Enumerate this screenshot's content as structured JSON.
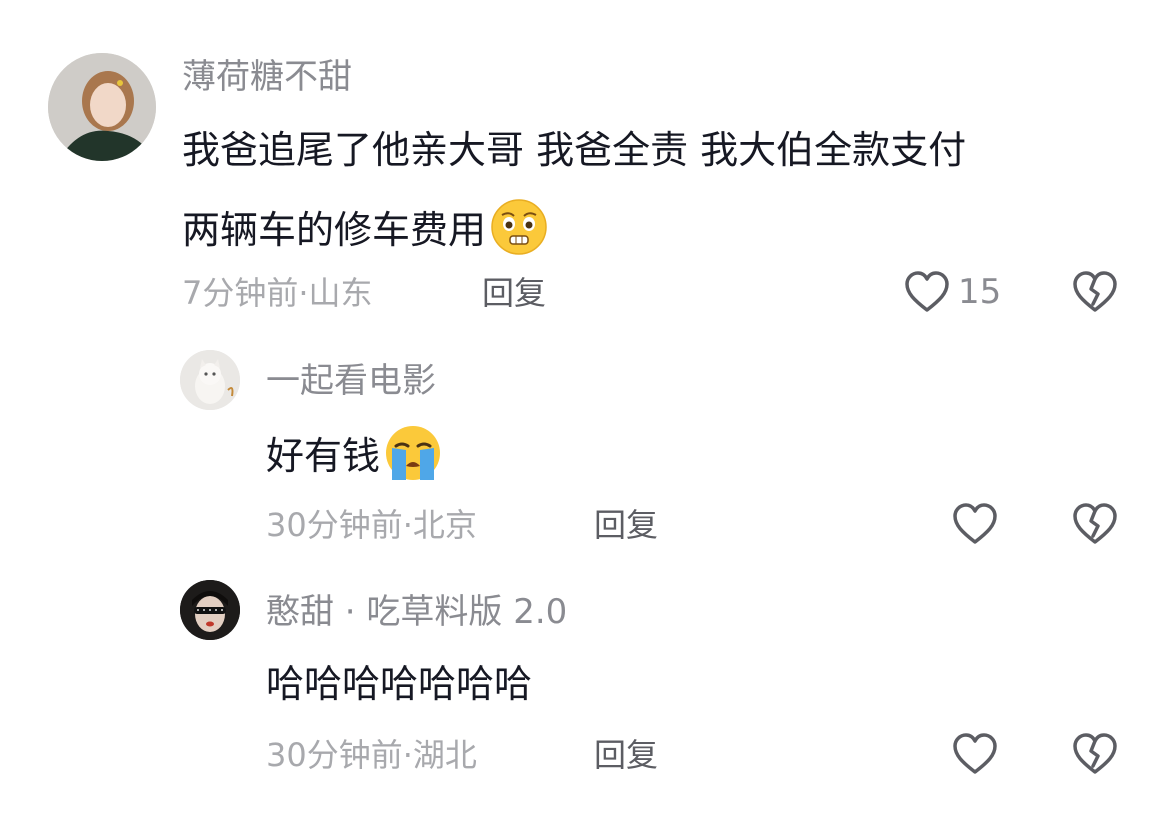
{
  "comments": [
    {
      "username": "薄荷糖不甜",
      "text_line1": "我爸追尾了他亲大哥 我爸全责 我大伯全款支付",
      "text_line2": "两辆车的修车费用",
      "emoji": "grimacing-pleading-face",
      "time": "7分钟前",
      "location": "山东",
      "reply_label": "回复",
      "likes": "15"
    },
    {
      "username": "一起看电影",
      "text": "好有钱",
      "emoji": "loudly-crying-face",
      "time": "30分钟前",
      "location": "北京",
      "reply_label": "回复",
      "likes": ""
    },
    {
      "username": "憨甜 · 吃草料版 2.0",
      "text": "哈哈哈哈哈哈哈",
      "time": "30分钟前",
      "location": "湖北",
      "reply_label": "回复",
      "likes": ""
    }
  ],
  "separator": " · ",
  "icons": {
    "like": "heart-outline-icon",
    "dislike": "broken-heart-icon"
  },
  "colors": {
    "text": "#161823",
    "username": "#8a8b91",
    "meta": "#a8a9ad",
    "icon": "#5c5d63"
  }
}
